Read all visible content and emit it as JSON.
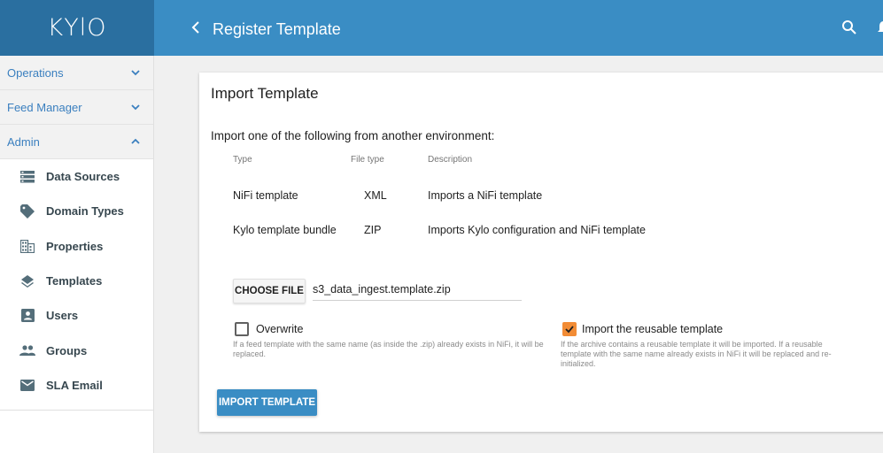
{
  "app": {
    "logo": "KYlO"
  },
  "header": {
    "title": "Register Template",
    "back_icon": "chevron-left-icon",
    "search_icon": "search-icon",
    "bell_icon": "bell-icon"
  },
  "sidebar": {
    "sections": [
      {
        "label": "Operations",
        "state": "collapsed"
      },
      {
        "label": "Feed Manager",
        "state": "collapsed"
      },
      {
        "label": "Admin",
        "state": "expanded"
      }
    ],
    "items": [
      {
        "label": "Data Sources",
        "icon": "storage-icon"
      },
      {
        "label": "Domain Types",
        "icon": "tag-icon"
      },
      {
        "label": "Properties",
        "icon": "business-icon"
      },
      {
        "label": "Templates",
        "icon": "layers-icon"
      },
      {
        "label": "Users",
        "icon": "person-box-icon"
      },
      {
        "label": "Groups",
        "icon": "group-icon"
      },
      {
        "label": "SLA Email",
        "icon": "email-icon"
      }
    ]
  },
  "card": {
    "title": "Import Template",
    "heading": "Import one of the following from another environment:",
    "table": {
      "headers": [
        "Type",
        "File type",
        "Description"
      ],
      "rows": [
        [
          "NiFi template",
          "XML",
          "Imports a NiFi template"
        ],
        [
          "Kylo template bundle",
          "ZIP",
          "Imports Kylo configuration and NiFi template"
        ]
      ]
    },
    "choose_file_label": "CHOOSE FILE",
    "file_name": "s3_data_ingest.template.zip",
    "overwrite": {
      "label": "Overwrite",
      "checked": false,
      "hint": "If a feed template with the same name (as inside the .zip) already exists in NiFi, it will be replaced."
    },
    "reusable": {
      "label": "Import the reusable template",
      "checked": true,
      "hint": "If the archive contains a reusable template it will be imported. If a reusable template with the same name already exists in NiFi it will be replaced and re-initialized."
    },
    "import_button": "IMPORT TEMPLATE"
  },
  "colors": {
    "toolbar": "#3a8dc4",
    "logo_bg": "#2a6fa0",
    "link": "#3a7fbf",
    "accent_checkbox": "#f28c35"
  }
}
